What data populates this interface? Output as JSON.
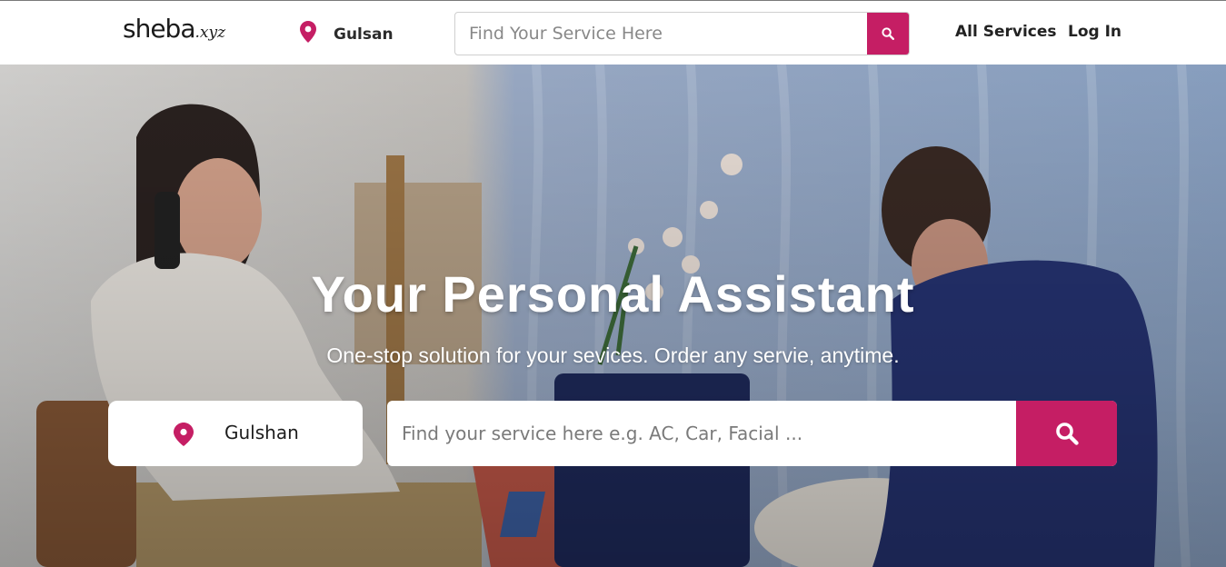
{
  "header": {
    "logo_main": "sheba",
    "logo_tld": ".xyz",
    "location": "Gulsan",
    "search_placeholder": "Find Your Service Here",
    "nav": {
      "all_services": "All Services",
      "login": "Log In"
    }
  },
  "hero": {
    "title": "Your Personal Assistant",
    "subtitle": "One-stop solution for your sevices. Order any servie, anytime.",
    "location": "Gulshan",
    "search_placeholder": "Find your service here e.g. AC, Car, Facial ..."
  },
  "icons": {
    "location_pin": "location-pin-icon",
    "search": "search-icon"
  },
  "colors": {
    "accent": "#c51e64"
  }
}
